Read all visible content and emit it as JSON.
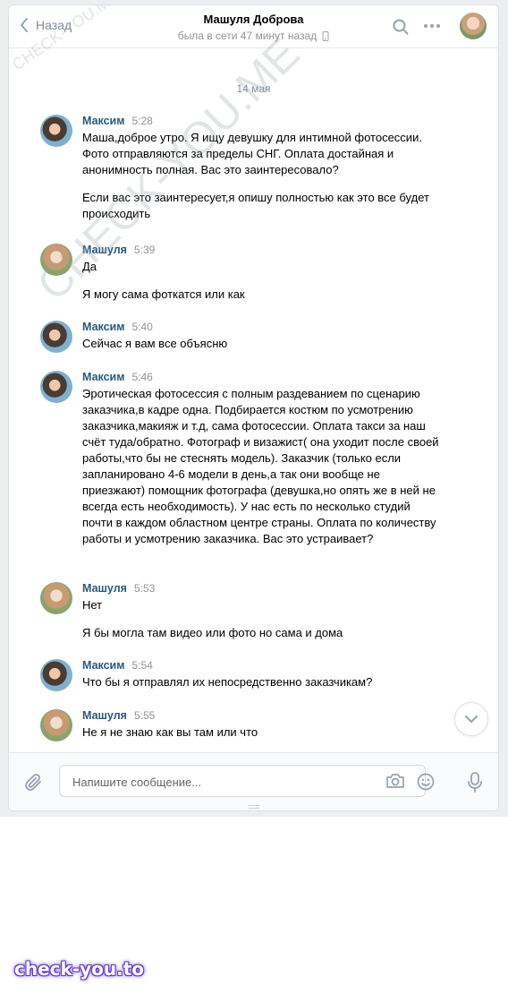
{
  "header": {
    "back_label": "Назад",
    "title": "Машуля Доброва",
    "status": "была в сети 47 минут назад"
  },
  "date_separator": "14 мая",
  "messages": [
    {
      "author": "Максим",
      "time": "5:28",
      "avatar": "maxim",
      "paragraphs": [
        "Маша,доброе утро. Я ищу девушку для интимной фотосессии. Фото отправляются за пределы СНГ. Оплата достайная и анонимность полная. Вас это заинтересовало?",
        "Если вас это заинтересует,я опишу полностью как это все будет происходить"
      ]
    },
    {
      "author": "Машуля",
      "time": "5:39",
      "avatar": "mashulya",
      "paragraphs": [
        "Да",
        "Я могу сама фоткатся или как"
      ]
    },
    {
      "author": "Максим",
      "time": "5:40",
      "avatar": "maxim",
      "paragraphs": [
        "Сейчас я вам все объясню"
      ]
    },
    {
      "author": "Максим",
      "time": "5:46",
      "avatar": "maxim",
      "paragraphs": [
        "Эротическая фотосессия с полным раздеванием по сценарию заказчика,в кадре одна. Подбирается костюм по усмотрению заказчика,макияж и т.д, сама фотосессии. Оплата такси за наш счёт туда/обратно. Фотограф и визажист( она уходит после своей работы,что бы не стеснять модель). Заказчик (только если запланировано 4-6 модели в день,а так они вообще не приезжают) помощник фотографа (девушка,но опять же в ней не всегда есть необходимость). У нас есть по несколько студий почти в каждом областном центре страны. Оплата по количеству работы и усмотрению заказчика. Вас это устраивает?"
      ]
    },
    {
      "author": "Машуля",
      "time": "5:53",
      "avatar": "mashulya",
      "paragraphs": [
        "Нет",
        "Я бы могла там видео или фото но сама и дома"
      ]
    },
    {
      "author": "Максим",
      "time": "5:54",
      "avatar": "maxim",
      "paragraphs": [
        "Что бы я отправлял их непосредственно заказчикам?"
      ]
    },
    {
      "author": "Машуля",
      "time": "5:55",
      "avatar": "mashulya",
      "paragraphs": [
        "Не я не знаю как вы там или что"
      ]
    }
  ],
  "composer": {
    "placeholder": "Напишите сообщение...",
    "value": ""
  },
  "watermarks": {
    "small": "CHECK-YOU.ME",
    "large": "CHECK-YOU.ME",
    "footer": "check-you.to"
  },
  "icons": [
    "back-chevron-icon",
    "mobile-icon",
    "search-icon",
    "more-icon",
    "chevron-down-icon",
    "paperclip-icon",
    "camera-icon",
    "emoji-icon",
    "microphone-icon"
  ],
  "colors": {
    "accent": "#2a5885",
    "muted": "#818c99",
    "icon": "#99a2ad",
    "notification_dot": "#ff5c5c"
  }
}
